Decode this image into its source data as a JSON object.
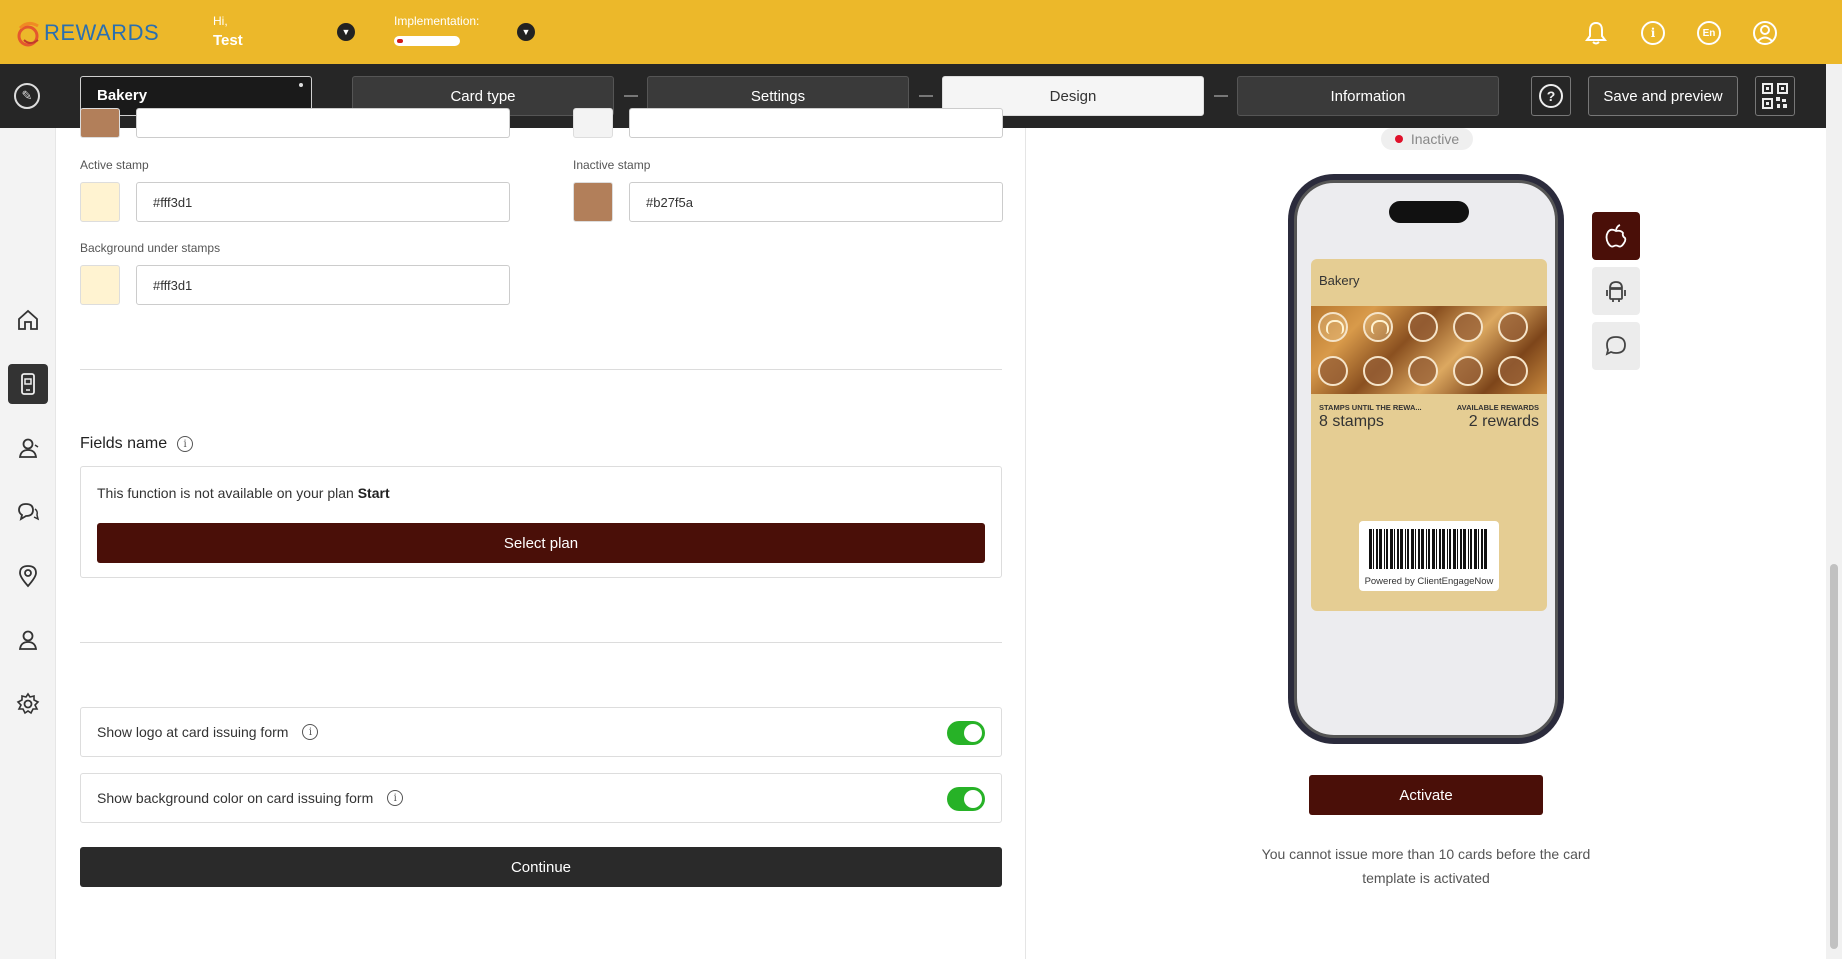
{
  "header": {
    "logo_text": "REWARDS",
    "greeting": "Hi,",
    "user_name": "Test",
    "implementation_label": "Implementation:",
    "implementation_progress": 0.1,
    "language": "En"
  },
  "nav": {
    "card_name": "Bakery",
    "steps": [
      {
        "label": "Card type"
      },
      {
        "label": "Settings"
      },
      {
        "label": "Design"
      },
      {
        "label": "Information"
      }
    ],
    "active_step": "Design",
    "help_label": "?",
    "save_label": "Save and preview"
  },
  "colors": {
    "active_stamp": {
      "label": "Active stamp",
      "value": "#fff3d1"
    },
    "inactive_stamp": {
      "label": "Inactive stamp",
      "value": "#b27f5a"
    },
    "background_under_stamps": {
      "label": "Background under stamps",
      "value": "#fff3d1"
    },
    "brand_dark": "#4a0f08",
    "topbar": "#ecb82a",
    "toggle_on": "#27b227"
  },
  "fields_name": {
    "title": "Fields name",
    "unavailable_text": "This function is not available on your plan",
    "plan_name": "Start",
    "select_plan_label": "Select plan"
  },
  "toggles": [
    {
      "label": "Show logo at card issuing form",
      "on": true
    },
    {
      "label": "Show background color on card issuing form",
      "on": true
    }
  ],
  "continue_label": "Continue",
  "preview": {
    "status": "Inactive",
    "pass": {
      "title": "Bakery",
      "stamps_total": 10,
      "stamps_active": 2,
      "left_label": "STAMPS UNTIL THE REWA...",
      "left_value": "8 stamps",
      "right_label": "AVAILABLE REWARDS",
      "right_value": "2 rewards",
      "powered_by": "Powered by ClientEngageNow"
    },
    "activate_label": "Activate",
    "note": "You cannot issue more than 10 cards before the card template is activated"
  }
}
